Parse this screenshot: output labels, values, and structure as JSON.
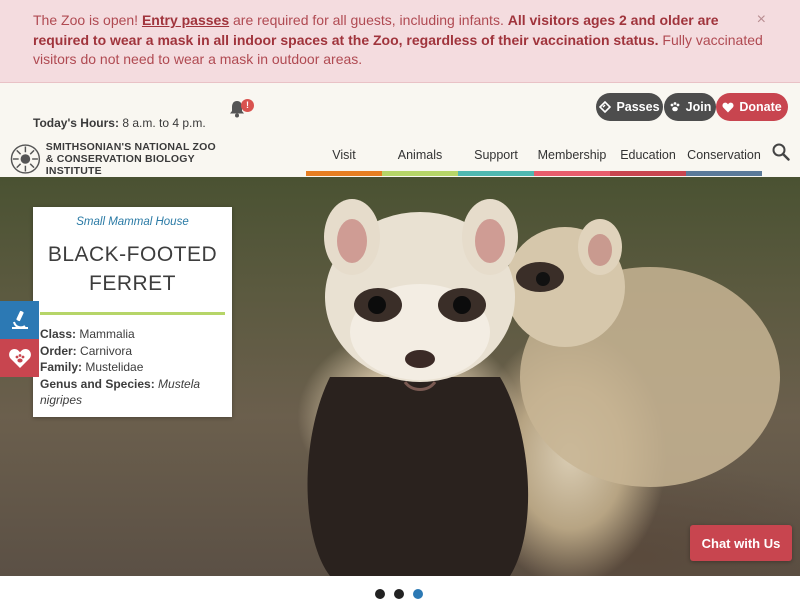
{
  "alert": {
    "text1": "The Zoo is open! ",
    "link": "Entry passes",
    "text2": " are required for all guests, including infants. ",
    "bold": "All visitors ages 2 and older are required to wear a mask in all indoor spaces at the Zoo, regardless of their vaccination status.",
    "text3": " Fully vaccinated visitors do not need to wear a mask in outdoor areas.",
    "close": "×"
  },
  "header": {
    "hours_label": "Today's Hours:",
    "hours_value": " 8 a.m. to 4 p.m.",
    "notification_badge": "!",
    "buttons": {
      "passes": "Passes",
      "join": "Join",
      "donate": "Donate"
    },
    "logo_line1": "SMITHSONIAN'S NATIONAL ZOO",
    "logo_line2": "& CONSERVATION BIOLOGY INSTITUTE"
  },
  "nav": [
    {
      "label": "Visit",
      "color": "#e67e22"
    },
    {
      "label": "Animals",
      "color": "#b6d568"
    },
    {
      "label": "Support",
      "color": "#4fb8b1"
    },
    {
      "label": "Membership",
      "color": "#e85d6c"
    },
    {
      "label": "Education",
      "color": "#c8454f"
    },
    {
      "label": "Conservation",
      "color": "#5b7a99"
    }
  ],
  "card": {
    "eyebrow": "Small Mammal House",
    "title": "BLACK-FOOTED FERRET",
    "class_label": "Class:",
    "class_value": " Mammalia",
    "order_label": "Order:",
    "order_value": " Carnivora",
    "family_label": "Family:",
    "family_value": " Mustelidae",
    "genus_label": "Genus and Species:",
    "genus_value": " Mustela nigripes"
  },
  "chat": "Chat with Us",
  "carousel": {
    "count": 3,
    "active": 3
  },
  "colors": {
    "accent": "#c8454f",
    "blue": "#2c79b4",
    "dark_pill": "#4d4d4d"
  }
}
